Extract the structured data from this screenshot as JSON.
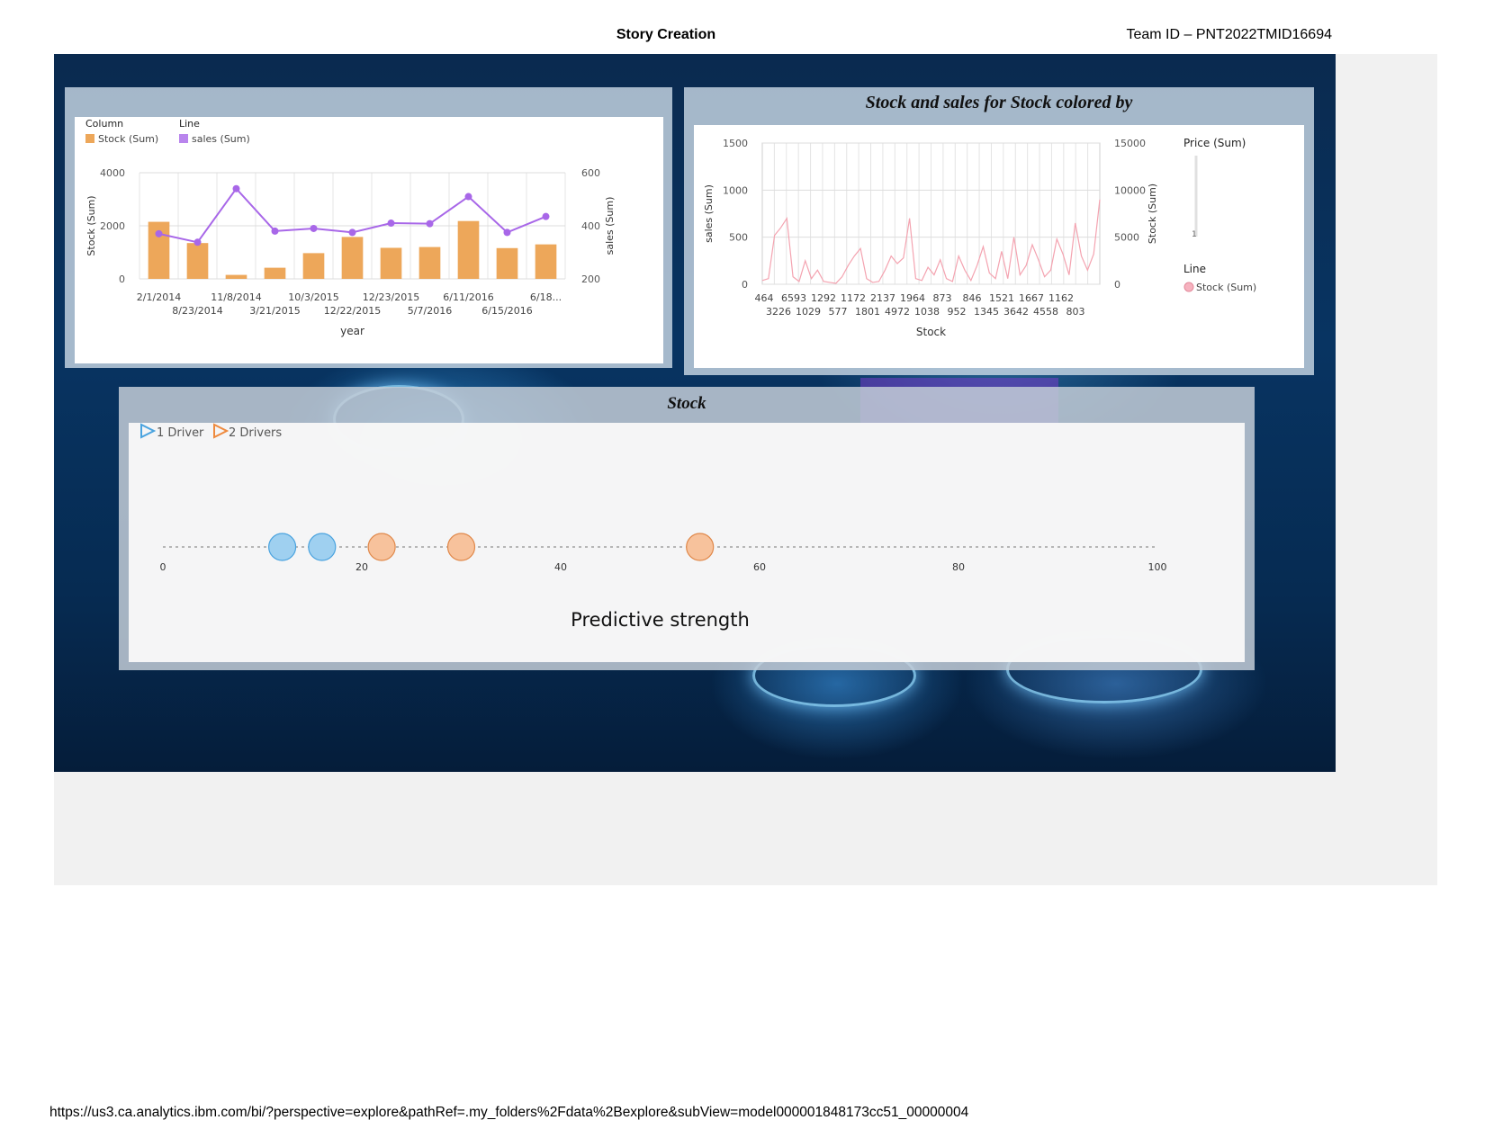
{
  "header": {
    "title": "Story Creation",
    "team_id": "Team ID – PNT2022TMID16694"
  },
  "footer": {
    "url": "https://us3.ca.analytics.ibm.com/bi/?perspective=explore&pathRef=.my_folders%2Fdata%2Bexplore&subView=model000001848173cc51_00000004"
  },
  "colors": {
    "stock_bar": "#eda75a",
    "sales_line": "#a867e8",
    "pink_line": "#f4a3b0",
    "driver1": "#9fd0f0",
    "driver2": "#f7c29c"
  },
  "chart_data": [
    {
      "type": "bar",
      "combo": "column-line",
      "legend": {
        "column_header": "Column",
        "column_item": "Stock (Sum)",
        "line_header": "Line",
        "line_item": "sales (Sum)"
      },
      "xlabel": "year",
      "ylabel": "Stock (Sum)",
      "y2label": "sales (Sum)",
      "ylim": [
        0,
        4000
      ],
      "y2lim": [
        200,
        600
      ],
      "yticks": [
        "4000",
        "2000",
        "0"
      ],
      "y2ticks": [
        "600",
        "400",
        "200"
      ],
      "categories": [
        "2/1/2014",
        "8/23/2014",
        "11/8/2014",
        "3/21/2015",
        "10/3/2015",
        "12/22/2015",
        "12/23/2015",
        "5/7/2016",
        "6/11/2016",
        "6/15/2016",
        "6/18..."
      ],
      "series": [
        {
          "name": "Stock (Sum)",
          "kind": "column",
          "values": [
            2150,
            1350,
            150,
            420,
            970,
            1580,
            1170,
            1200,
            2180,
            1160,
            1300
          ]
        },
        {
          "name": "sales (Sum)",
          "kind": "line",
          "values": [
            370,
            338,
            540,
            380,
            390,
            375,
            410,
            408,
            510,
            375,
            435
          ]
        }
      ]
    },
    {
      "type": "line",
      "title": "Stock and sales for Stock colored by",
      "xlabel": "Stock",
      "ylabel": "sales (Sum)",
      "y2label": "Stock (Sum)",
      "ylim": [
        0,
        1500
      ],
      "y2lim": [
        0,
        15000
      ],
      "yticks": [
        "1500",
        "1000",
        "500",
        "0"
      ],
      "y2ticks": [
        "15000",
        "10000",
        "5000",
        "0"
      ],
      "x_ticks_top": [
        "464",
        "6593",
        "1292",
        "1172",
        "2137",
        "1964",
        "873",
        "846",
        "1521",
        "1667",
        "1162"
      ],
      "x_ticks_bottom": [
        "3226",
        "1029",
        "577",
        "1801",
        "4972",
        "1038",
        "952",
        "1345",
        "3642",
        "4558",
        "803"
      ],
      "legend": {
        "price_header": "Price (Sum)",
        "price_value": "1",
        "line_header": "Line",
        "line_item": "Stock (Sum)"
      },
      "series": [
        {
          "name": "Stock (Sum)",
          "values": [
            40,
            60,
            520,
            600,
            700,
            80,
            30,
            250,
            60,
            150,
            30,
            20,
            10,
            80,
            200,
            300,
            380,
            60,
            20,
            30,
            150,
            300,
            220,
            280,
            700,
            60,
            40,
            180,
            100,
            260,
            60,
            30,
            300,
            150,
            40,
            200,
            400,
            120,
            60,
            350,
            60,
            500,
            100,
            200,
            420,
            260,
            80,
            150,
            480,
            320,
            100,
            650,
            300,
            150,
            320,
            900
          ]
        }
      ]
    },
    {
      "type": "scatter",
      "title": "Stock",
      "xlabel": "Predictive strength",
      "xlim": [
        0,
        100
      ],
      "xticks": [
        "0",
        "20",
        "40",
        "60",
        "80",
        "100"
      ],
      "legend": [
        {
          "name": "1 Driver"
        },
        {
          "name": "2 Drivers"
        }
      ],
      "series": [
        {
          "name": "1 Driver",
          "x": [
            12,
            16
          ]
        },
        {
          "name": "2 Drivers",
          "x": [
            22,
            30,
            54
          ]
        }
      ]
    }
  ]
}
